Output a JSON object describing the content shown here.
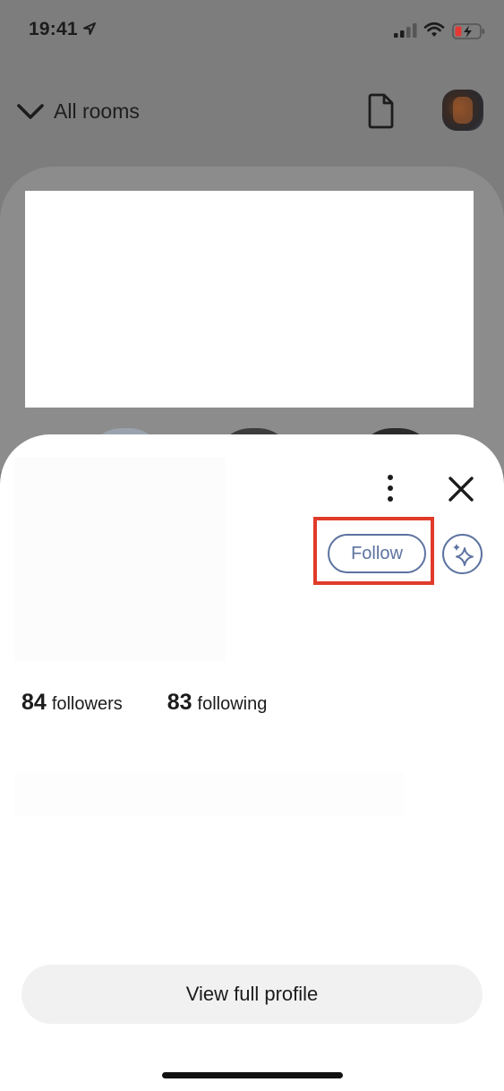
{
  "status_bar": {
    "time": "19:41"
  },
  "nav": {
    "rooms_label": "All rooms"
  },
  "profile": {
    "follow_label": "Follow",
    "followers_count": "84",
    "followers_label": "followers",
    "following_count": "83",
    "following_label": "following",
    "view_profile_label": "View full profile"
  },
  "icons": {
    "location": "location-arrow-icon",
    "signal": "cellular-signal-icon",
    "wifi": "wifi-icon",
    "battery": "battery-charging-icon",
    "rooms_toggle": "chevron-down-icon",
    "document": "document-icon",
    "more": "vertical-ellipsis-icon",
    "close": "close-icon",
    "ping": "sparkle-icon"
  },
  "colors": {
    "accent": "#5c72a0",
    "highlight": "#e03b2a",
    "overlay": "#7d7d7d",
    "sheet": "#ffffff",
    "button_bg": "#f1f1f1",
    "battery_charge": "#e53935"
  }
}
